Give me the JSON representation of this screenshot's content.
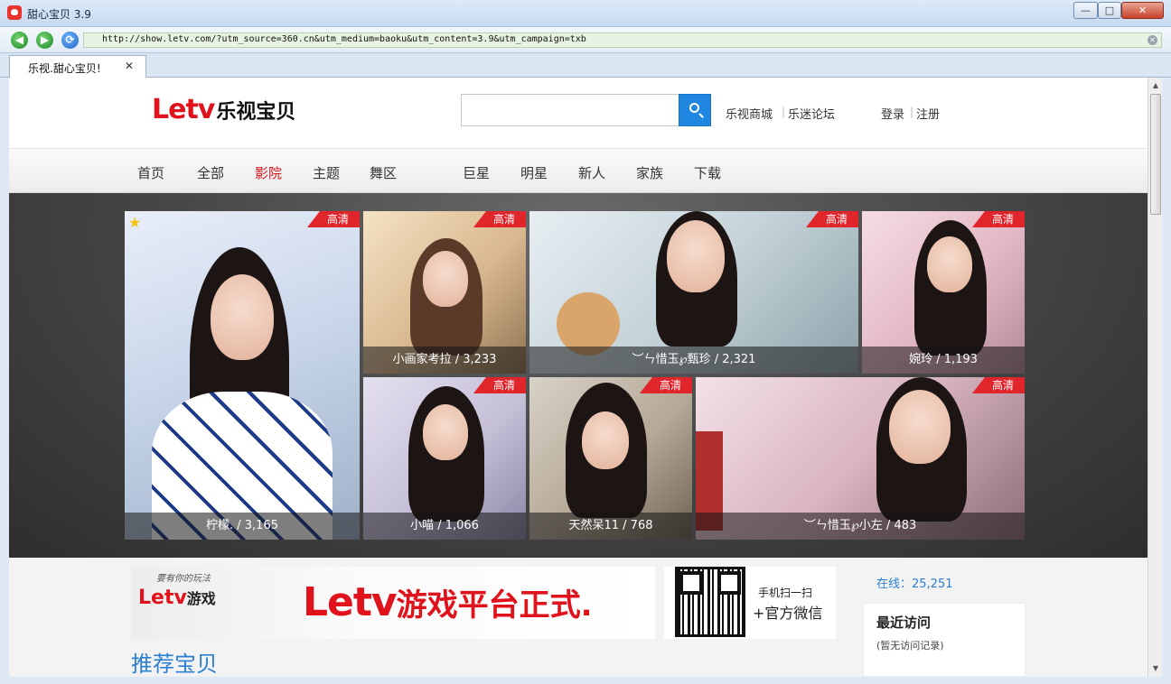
{
  "window": {
    "title": "甜心宝贝 3.9",
    "min_glyph": "—",
    "max_glyph": "□",
    "close_glyph": "✕"
  },
  "browser": {
    "url": "http://show.letv.com/?utm_source=360.cn&utm_medium=baoku&utm_content=3.9&utm_campaign=txb",
    "back_glyph": "◀",
    "fwd_glyph": "▶",
    "refresh_glyph": "⟳",
    "clear_glyph": "✕",
    "tab_label": "乐视.甜心宝贝!",
    "tab_close_glyph": "✕"
  },
  "header": {
    "logo_en": "Letv",
    "logo_cn": "乐视宝贝",
    "search_placeholder": "",
    "links": [
      "乐视商城",
      "乐迷论坛"
    ],
    "login": "登录",
    "register": "注册",
    "separator": "|"
  },
  "categories": {
    "items": [
      "首页",
      "全部",
      "影院",
      "主题",
      "舞区",
      "巨星",
      "明星",
      "新人",
      "家族",
      "下载"
    ],
    "active": "影院"
  },
  "featured": {
    "hd_label": "高清",
    "star_glyph": "★",
    "tiles": [
      {
        "caption": "柠檬. / 3,165"
      },
      {
        "caption": "小画家考拉 / 3,233"
      },
      {
        "caption": "︶ㄣ惜玉℘甄珍 / 2,321"
      },
      {
        "caption": "婉玲 / 1,193"
      },
      {
        "caption": "小喵 / 1,066"
      },
      {
        "caption": "天然呆11 / 768"
      },
      {
        "caption": "︶ㄣ惜玉℘小左 / 483"
      }
    ]
  },
  "banner": {
    "tagline": "要有你的玩法",
    "small_en": "Letv",
    "small_cn": "游戏",
    "big_en": "Letv",
    "big_cn": "游戏平台正式."
  },
  "qr": {
    "line1": "手机扫一扫",
    "line2": "+官方微信"
  },
  "sidebar": {
    "online": "在线：25,251",
    "recent_title": "最近访问",
    "recent_empty": "(暂无访问记录)"
  },
  "section": {
    "title": "推荐宝贝"
  },
  "colors": {
    "brand_red": "#e0121b",
    "link_blue": "#2a7fd0",
    "search_blue": "#1f87e0"
  }
}
